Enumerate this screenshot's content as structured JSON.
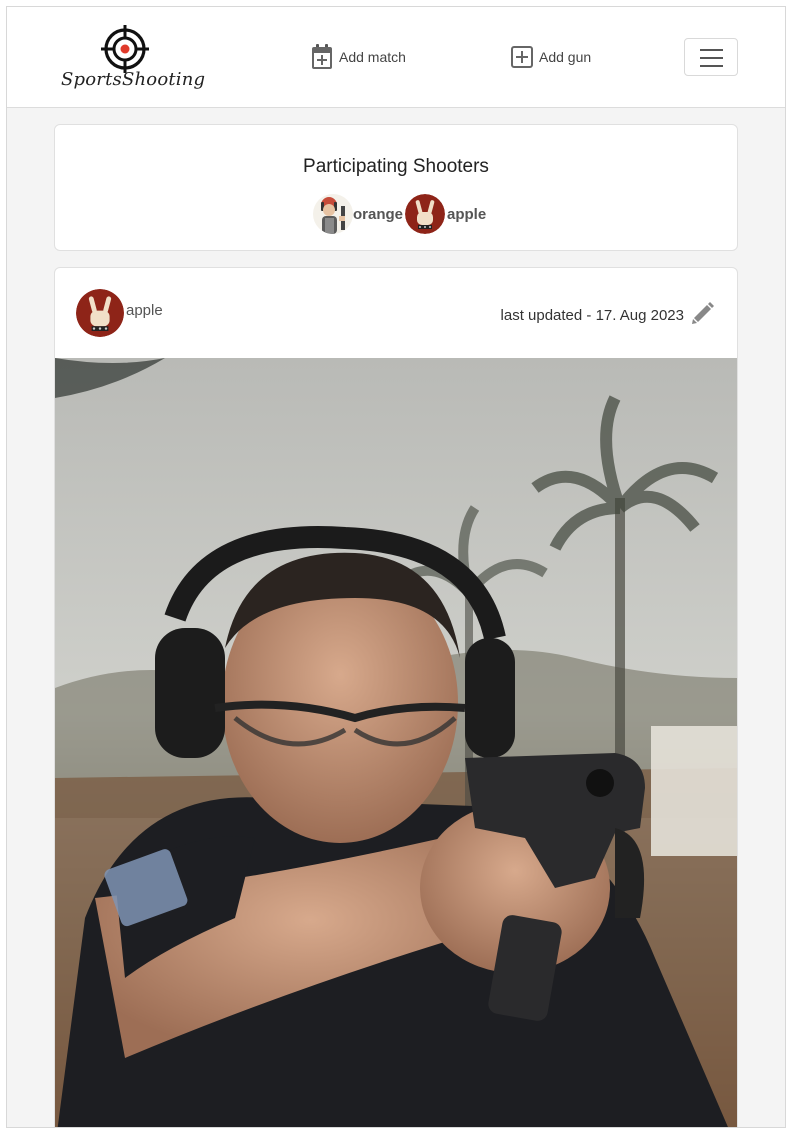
{
  "navbar": {
    "brand": "SportsShooting",
    "links": [
      {
        "label": "Add match",
        "icon": "calendar-plus-icon"
      },
      {
        "label": "Add gun",
        "icon": "plus-square-icon"
      }
    ],
    "toggler_icon": "hamburger-icon"
  },
  "shooters": {
    "title": "Participating Shooters",
    "list": [
      {
        "name": "orange",
        "avatar": "cartoon-shooter-avatar"
      },
      {
        "name": "apple",
        "avatar": "rock-hand-avatar"
      }
    ]
  },
  "post": {
    "author": "apple",
    "author_avatar": "rock-hand-avatar",
    "updated": "last updated - 17. Aug 2023",
    "edit_icon": "pencil-icon",
    "image": "photo of shooter aiming pistol"
  },
  "colors": {
    "accent_red": "#c0392b",
    "avatar_red": "#8e2418",
    "page_bg": "#f4f4f4"
  }
}
